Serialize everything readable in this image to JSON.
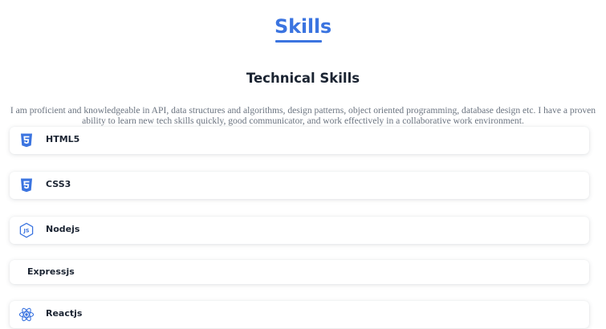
{
  "section": {
    "title": "Skills",
    "subtitle": "Technical Skills",
    "intro": "I am proficient and knowledgeable in API, data structures and algorithms, design patterns, object oriented programming, database design etc. I have a proven ability to learn new tech skills quickly, good communicator, and work effectively in a collaborative work environment."
  },
  "colors": {
    "accent": "#3b74e0",
    "heading": "#1b2432",
    "body_text": "#6b7480"
  },
  "skills": [
    {
      "label": "HTML5",
      "icon": "html5-icon"
    },
    {
      "label": "CSS3",
      "icon": "css3-icon"
    },
    {
      "label": "Nodejs",
      "icon": "nodejs-icon"
    },
    {
      "label": "Expressjs",
      "icon": ""
    },
    {
      "label": "Reactjs",
      "icon": "react-icon"
    }
  ]
}
